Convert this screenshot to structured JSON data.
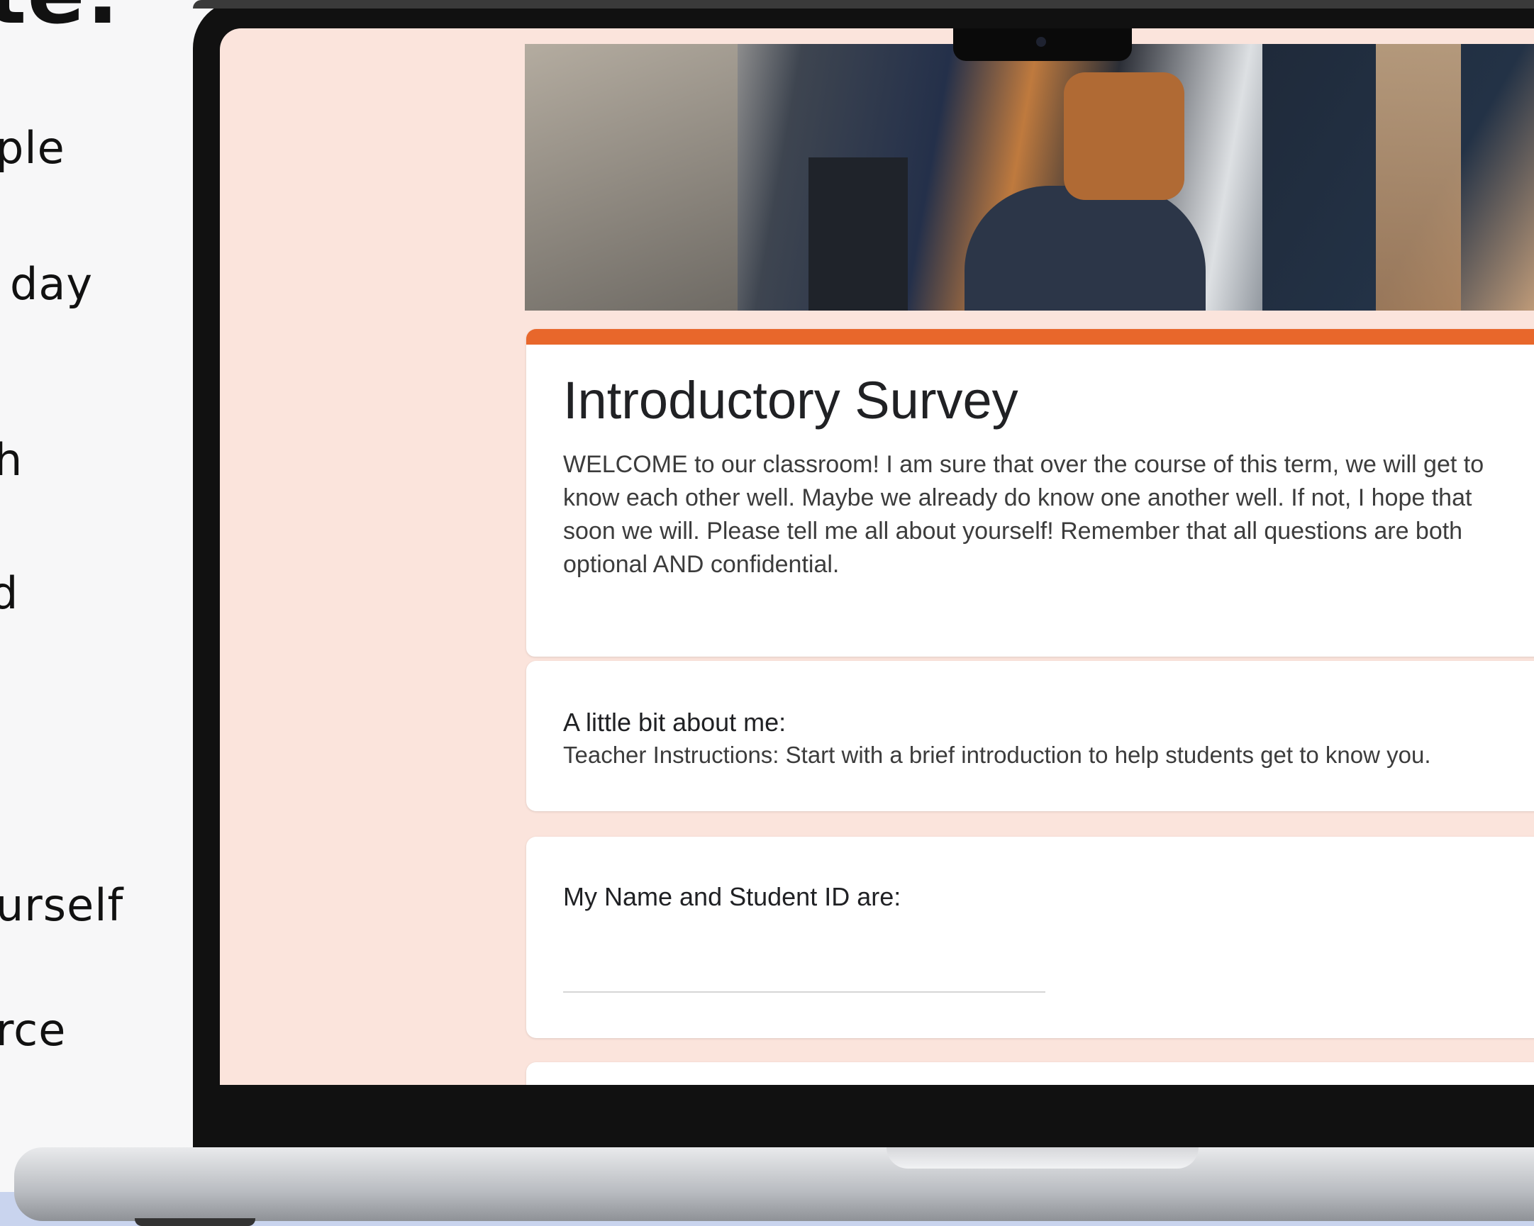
{
  "side_text": {
    "heading": "te:",
    "lines": [
      "ple",
      "day",
      "h",
      "d",
      "urself",
      "rce"
    ]
  },
  "form": {
    "title": "Introductory Survey",
    "description": "WELCOME to our classroom! I am sure that over the course of this term, we will get to know each other well. Maybe we already do know one another well. If not, I hope that soon we will. Please tell me all about yourself! Remember that all questions are both optional AND confidential.",
    "accent_color": "#e8672b",
    "background_color": "#fbe4dc",
    "section": {
      "title": "A little bit about me:",
      "description": "Teacher Instructions: Start with a brief introduction to help students get to know you."
    },
    "question": {
      "label": "My Name and Student ID are:",
      "value": ""
    }
  }
}
